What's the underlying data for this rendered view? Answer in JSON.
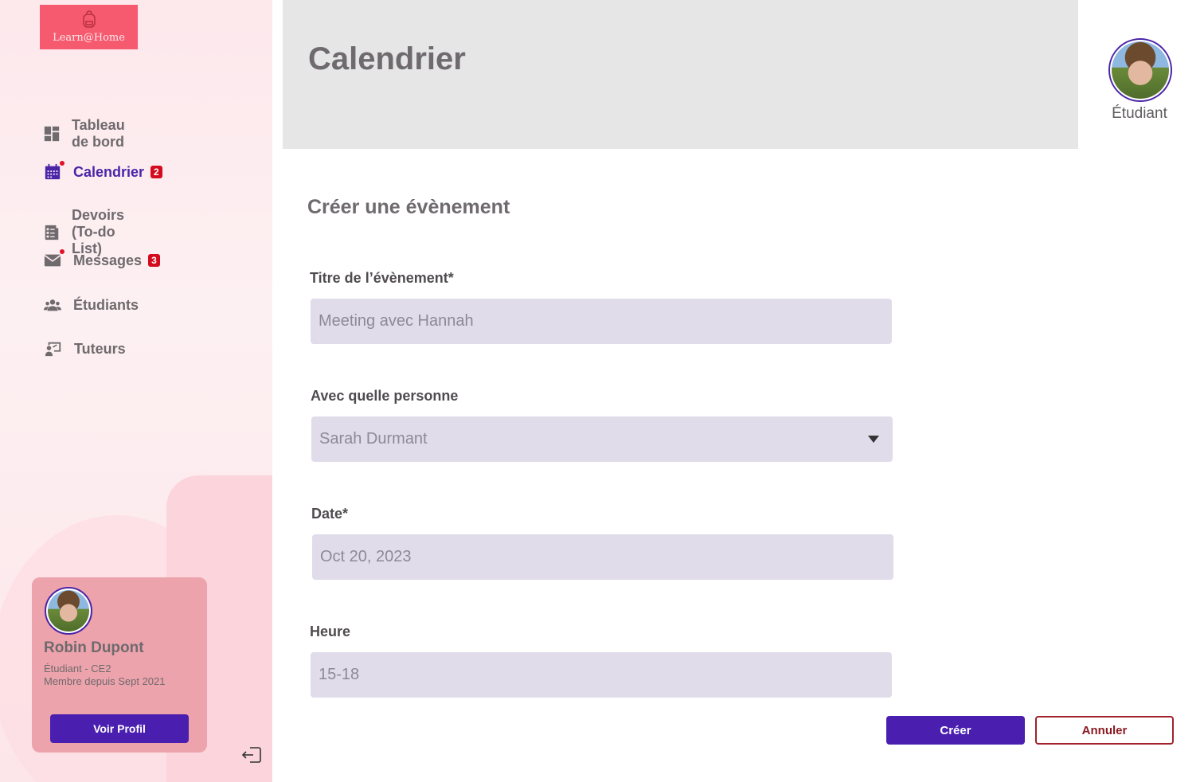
{
  "app": {
    "logo_text": "Learn@Home"
  },
  "sidebar": {
    "items": [
      {
        "label": "Tableau de bord",
        "icon": "dashboard-icon",
        "active": false
      },
      {
        "label": "Calendrier",
        "icon": "calendar-icon",
        "active": true,
        "badge": "2"
      },
      {
        "label": "Devoirs (To-do List)",
        "icon": "todo-list-icon",
        "active": false
      },
      {
        "label": "Messages",
        "icon": "mail-icon",
        "active": false,
        "badge": "3"
      },
      {
        "label": "Étudiants",
        "icon": "students-icon",
        "active": false
      },
      {
        "label": "Tuteurs",
        "icon": "tutors-icon",
        "active": false
      }
    ],
    "profile": {
      "name": "Robin Dupont",
      "line1": "Étudiant - CE2",
      "line2": "Membre depuis Sept 2021",
      "button": "Voir Profil"
    }
  },
  "header": {
    "title": "Calendrier",
    "user_role": "Étudiant"
  },
  "form": {
    "title": "Créer une évènement",
    "fields": {
      "title_label": "Titre de l’évènement*",
      "title_value": "Meeting avec Hannah",
      "person_label": "Avec quelle personne",
      "person_value": "Sarah Durmant",
      "date_label": "Date*",
      "date_value": "Oct 20, 2023",
      "time_label": "Heure",
      "time_value": "15-18"
    },
    "create_label": "Créer",
    "cancel_label": "Annuler"
  },
  "colors": {
    "accent": "#4a1fb0",
    "brand": "#f65a6f",
    "badge": "#d40b1f",
    "field_bg": "#e0dcea"
  }
}
